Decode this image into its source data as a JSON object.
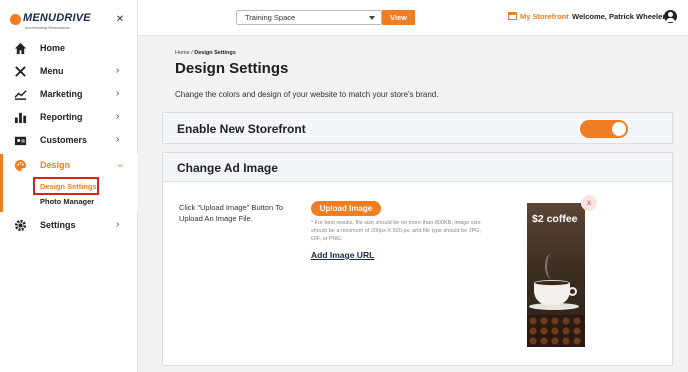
{
  "brand": {
    "name": "MENUDRIVE",
    "tagline": "Accelerating Restaurants",
    "accent": "#ef7d22"
  },
  "topbar": {
    "space_select": "Training Space",
    "view_label": "View",
    "storefront_label": "My Storefront",
    "welcome": "Welcome, Patrick Wheeler"
  },
  "sidebar": {
    "items": [
      {
        "label": "Home",
        "icon": "home-icon"
      },
      {
        "label": "Menu",
        "icon": "utensils-icon"
      },
      {
        "label": "Marketing",
        "icon": "trend-chart-icon"
      },
      {
        "label": "Reporting",
        "icon": "bar-chart-icon"
      },
      {
        "label": "Customers",
        "icon": "contact-card-icon"
      },
      {
        "label": "Design",
        "icon": "palette-icon"
      },
      {
        "label": "Settings",
        "icon": "gear-icon"
      }
    ],
    "design_sub": [
      "Design Settings",
      "Photo Manager"
    ]
  },
  "main": {
    "breadcrumb_home": "Home",
    "breadcrumb_sep": "/",
    "breadcrumb_current": "Design Settings",
    "title": "Design Settings",
    "description": "Change the colors and design of your website to match your store's brand.",
    "storefront_card_title": "Enable New Storefront",
    "storefront_enabled": true,
    "ad_card_title": "Change Ad Image",
    "instructions": "Click \"Upload Image\" Button To Upload An Image File.",
    "upload_label": "Upload Image",
    "note": "* For best results, file size should be no more than 800KB, image size should be a minimum of 200px X 500 px, and file type should be JPG, GIF, or PNG.",
    "add_url_label": "Add Image URL",
    "ad_text": "$2 coffee",
    "remove_label": "x"
  }
}
